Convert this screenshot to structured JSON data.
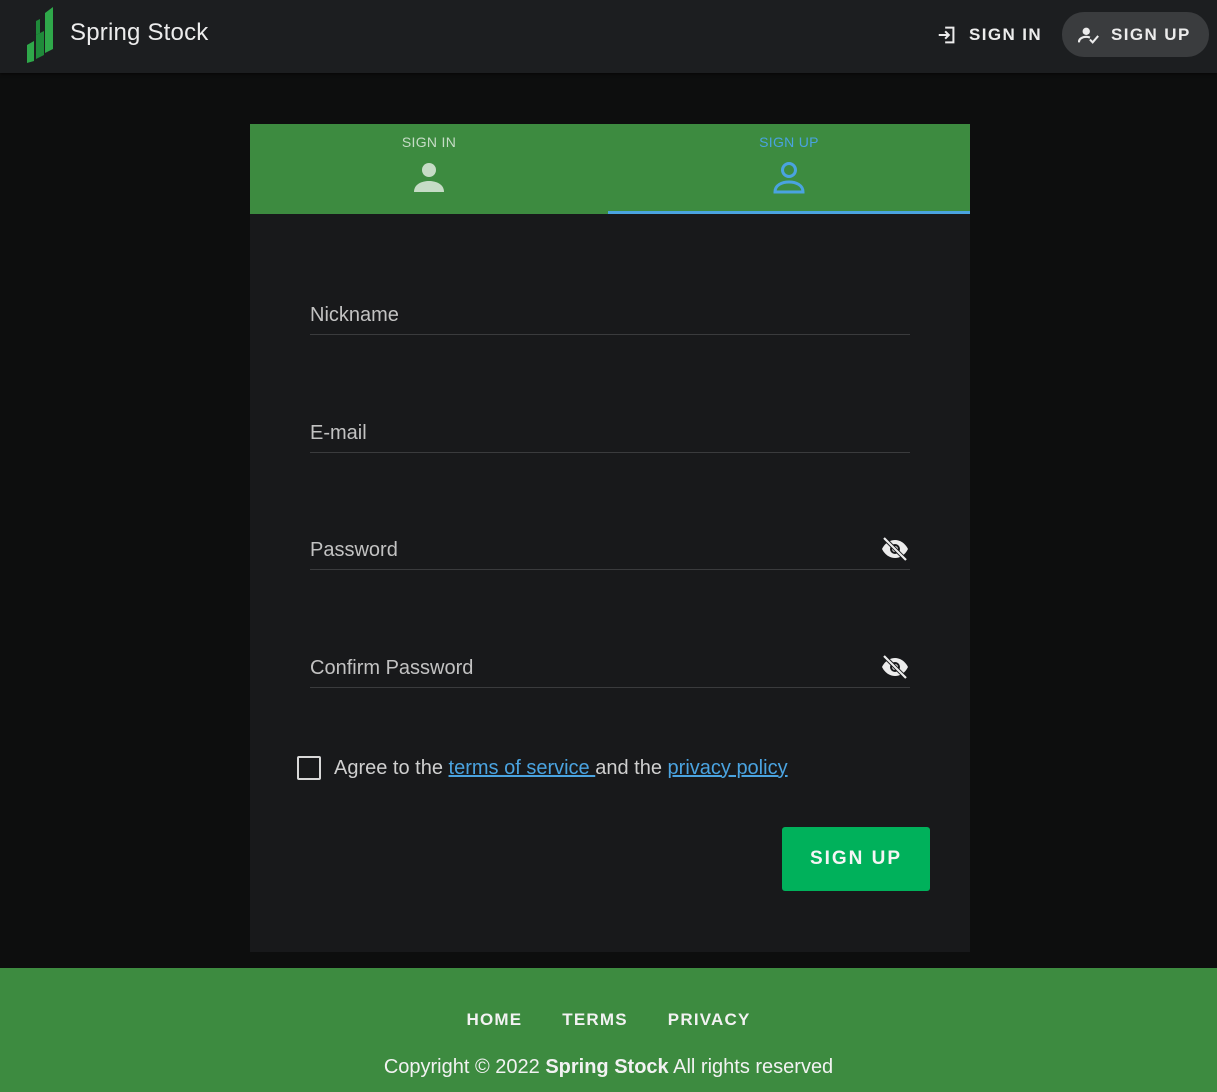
{
  "header": {
    "brand": "Spring Stock",
    "sign_in_label": "SIGN IN",
    "sign_up_label": "SIGN UP"
  },
  "tabs": [
    {
      "label": "SIGN IN",
      "icon": "person-filled-icon",
      "active": false
    },
    {
      "label": "SIGN UP",
      "icon": "person-outline-icon",
      "active": true
    }
  ],
  "form": {
    "nickname": {
      "placeholder": "Nickname",
      "value": ""
    },
    "email": {
      "placeholder": "E-mail",
      "value": ""
    },
    "password": {
      "placeholder": "Password",
      "value": ""
    },
    "confirm_password": {
      "placeholder": "Confirm Password",
      "value": ""
    },
    "agree": {
      "checked": false,
      "prefix": "Agree to the ",
      "terms_link": "terms of service ",
      "middle": "and the ",
      "privacy_link": "privacy policy"
    },
    "submit_label": "SIGN UP"
  },
  "footer": {
    "links": [
      "HOME",
      "TERMS",
      "PRIVACY"
    ],
    "copyright_prefix": "Copyright © 2022 ",
    "copyright_brand": "Spring Stock",
    "copyright_suffix": " All rights reserved"
  },
  "colors": {
    "topbar": "#1c1e20",
    "green": "#3d8b40",
    "accent_blue": "#4aa3e0",
    "submit_green": "#00b15b",
    "card": "#18191b",
    "page": "#0d0e0e"
  }
}
